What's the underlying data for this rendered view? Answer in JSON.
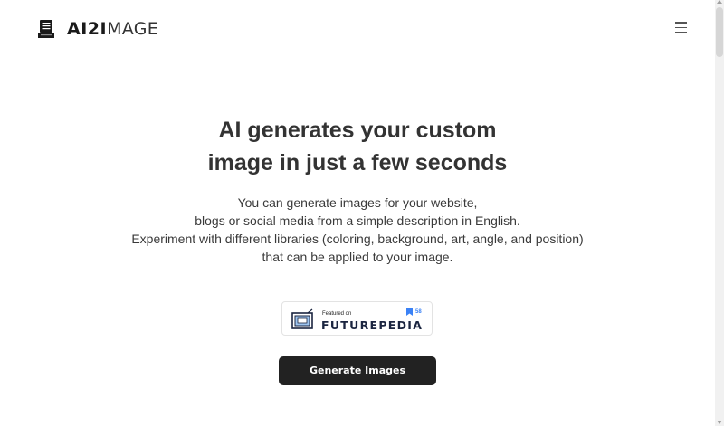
{
  "header": {
    "logo_bold": "AI2I",
    "logo_light": "MAGE",
    "logo_icon": "document-icon",
    "menu_icon": "hamburger-menu-icon"
  },
  "hero": {
    "title_line1": "AI generates your custom",
    "title_line2": "image in just a few seconds",
    "text_line1": "You can generate images for your website,",
    "text_line2": "blogs or social media from a simple description in English.",
    "text_line3": "Experiment with different libraries (coloring, background, art, angle, and position)",
    "text_line4": "that can be applied to your image."
  },
  "badge": {
    "small_text": "Featured on",
    "big_text": "FUTUREPEDIA",
    "count": "58",
    "icon": "bookmark-icon"
  },
  "cta": {
    "label": "Generate Images"
  },
  "colors": {
    "button_bg": "#222222",
    "text": "#333333",
    "badge_accent": "#3b82f6"
  }
}
